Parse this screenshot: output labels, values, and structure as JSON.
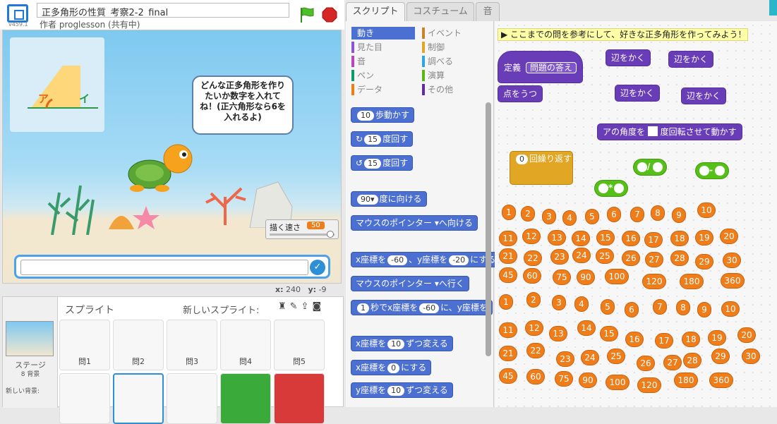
{
  "app": {
    "version": "v459.1",
    "project_title": "正多角形の性質_考察2-2_final",
    "author_line": "作者 proglesson (共有中)"
  },
  "stage": {
    "speech": "どんな正多角形を作りたいか数字を入れてね！(正六角形なら6を入れるよ)",
    "panel_labels": [
      "ア",
      "イ"
    ],
    "slider": {
      "label": "描く速さ",
      "value": "50"
    },
    "coords": {
      "x_label": "x:",
      "x": "240",
      "y_label": "y:",
      "y": "-9"
    }
  },
  "sprites": {
    "header": "スプライト",
    "new_sprite": "新しいスプライト:",
    "stage_label": "ステージ",
    "stage_count": "8 背景",
    "new_backdrop": "新しい背景:",
    "items": [
      {
        "name": "問1"
      },
      {
        "name": "問2"
      },
      {
        "name": "問3"
      },
      {
        "name": "問4"
      },
      {
        "name": "問5"
      }
    ]
  },
  "tabs": [
    "スクリプト",
    "コスチューム",
    "音"
  ],
  "categories": [
    {
      "label": "動き",
      "color": "#4c6fd2",
      "selected": true
    },
    {
      "label": "イベント",
      "color": "#c88330"
    },
    {
      "label": "見た目",
      "color": "#8a55d7"
    },
    {
      "label": "制御",
      "color": "#e1a624"
    },
    {
      "label": "音",
      "color": "#bb42c3"
    },
    {
      "label": "調べる",
      "color": "#2ca5e2"
    },
    {
      "label": "ペン",
      "color": "#0e9a6c"
    },
    {
      "label": "演算",
      "color": "#5cb712"
    },
    {
      "label": "データ",
      "color": "#ee7d16"
    },
    {
      "label": "その他",
      "color": "#632d99"
    }
  ],
  "palette_blocks": [
    {
      "pre": "",
      "pill": "10",
      "post": "歩動かす"
    },
    {
      "pre": "↻",
      "pill": "15",
      "post": "度回す"
    },
    {
      "pre": "↺",
      "pill": "15",
      "post": "度回す"
    },
    {
      "pre": "",
      "pill": "90▾",
      "post": "度に向ける"
    },
    {
      "pre": "マウスのポインター ▾",
      "pill": "",
      "post": "へ向ける"
    },
    {
      "pre": "x座標を",
      "pill": "-60",
      "post": "、y座標を",
      "pill2": "-20",
      "post2": "にする"
    },
    {
      "pre": "マウスのポインター ▾",
      "pill": "",
      "post": "へ行く"
    },
    {
      "pre": "",
      "pill": "1",
      "post": "秒でx座標を",
      "pill2": "-60",
      "post2": "に、y座標を"
    },
    {
      "pre": "x座標を",
      "pill": "10",
      "post": "ずつ変える"
    },
    {
      "pre": "x座標を",
      "pill": "0",
      "post": "にする"
    },
    {
      "pre": "y座標を",
      "pill": "10",
      "post": "ずつ変える"
    }
  ],
  "script": {
    "note": "▶ ここまでの問を参考にして、好きな正多角形を作ってみよう！",
    "define_label": "定義",
    "define_name": "問題の答え",
    "pen_down": "点をうつ",
    "draw_edge": "辺をかく",
    "move_angle_pre": "アの角度を",
    "move_angle_post": "度回転させて動かす",
    "repeat_pill": "0",
    "repeat_label": "回繰り返す",
    "numbers_a": [
      "1",
      "2",
      "3",
      "4",
      "5",
      "6",
      "7",
      "8",
      "9",
      "10",
      "11",
      "12",
      "13",
      "14",
      "15",
      "16",
      "17",
      "18",
      "19",
      "20",
      "21",
      "22",
      "23",
      "24",
      "25",
      "26",
      "27",
      "28",
      "29",
      "30",
      "45",
      "60",
      "75",
      "90",
      "100",
      "120",
      "180",
      "360"
    ],
    "numbers_b": [
      "1",
      "2",
      "3",
      "4",
      "5",
      "6",
      "7",
      "8",
      "9",
      "10",
      "11",
      "12",
      "13",
      "14",
      "15",
      "16",
      "17",
      "18",
      "19",
      "20",
      "21",
      "22",
      "23",
      "24",
      "25",
      "26",
      "27",
      "28",
      "29",
      "30",
      "45",
      "60",
      "75",
      "90",
      "100",
      "120",
      "180",
      "360"
    ]
  }
}
